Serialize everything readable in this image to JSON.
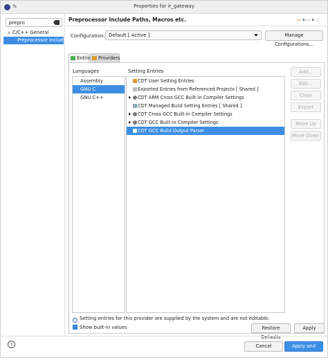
{
  "window": {
    "title": "Properties for ir_gateway"
  },
  "left": {
    "filter_value": "prepro",
    "tree": [
      {
        "label": "C/C++ General",
        "level": 0,
        "expanded": true
      },
      {
        "label": "Preprocessor Include Paths, Macros etc.",
        "display": "Preprocessor Include",
        "level": 1,
        "selected": true
      }
    ]
  },
  "page": {
    "title": "Preprocessor Include Paths, Macros etc.",
    "configuration_label": "Configuration:",
    "configuration_value": "Default  [ Active ]",
    "manage_configurations": "Manage Configurations...",
    "tabs": [
      {
        "label": "Entries",
        "active": false
      },
      {
        "label": "Providers",
        "active": true
      }
    ],
    "languages_header": "Languages",
    "languages": [
      "Assembly",
      "GNU C",
      "GNU C++"
    ],
    "selected_language": "GNU C",
    "entries_header": "Setting Entries",
    "entries": [
      {
        "label": "CDT User Setting Entries",
        "icon": "user-icon",
        "expandable": false
      },
      {
        "label": "Exported Entries from Referenced Projects   [ Shared ]",
        "icon": "exported-icon",
        "expandable": false
      },
      {
        "label": "CDT ARM Cross GCC Built-in Compiler Settings",
        "icon": "compiler-icon",
        "expandable": true
      },
      {
        "label": "CDT Managed Build Setting Entries   [ Shared ]",
        "icon": "managed-icon",
        "expandable": false
      },
      {
        "label": "CDT Cross GCC Built-in Compiler Settings",
        "icon": "compiler-icon",
        "expandable": true
      },
      {
        "label": "CDT GCC Built-in Compiler Settings",
        "icon": "compiler-icon",
        "expandable": true
      },
      {
        "label": "CDT GCC Build Output Parser",
        "icon": "parser-icon",
        "expandable": false,
        "selected": true
      }
    ],
    "side_buttons": {
      "add": "Add...",
      "edit": "Edit...",
      "clear": "Clear Entries",
      "export": "Export",
      "move_up": "Move Up",
      "move_down": "Move Down"
    },
    "info_text": "Setting entries for this provider are supplied by the system and are not editable.",
    "show_builtin_label": "Show built-in values",
    "show_builtin_checked": true,
    "restore_defaults": "Restore Defaults",
    "apply": "Apply"
  },
  "footer": {
    "cancel": "Cancel",
    "apply_close": "Apply and Close"
  }
}
